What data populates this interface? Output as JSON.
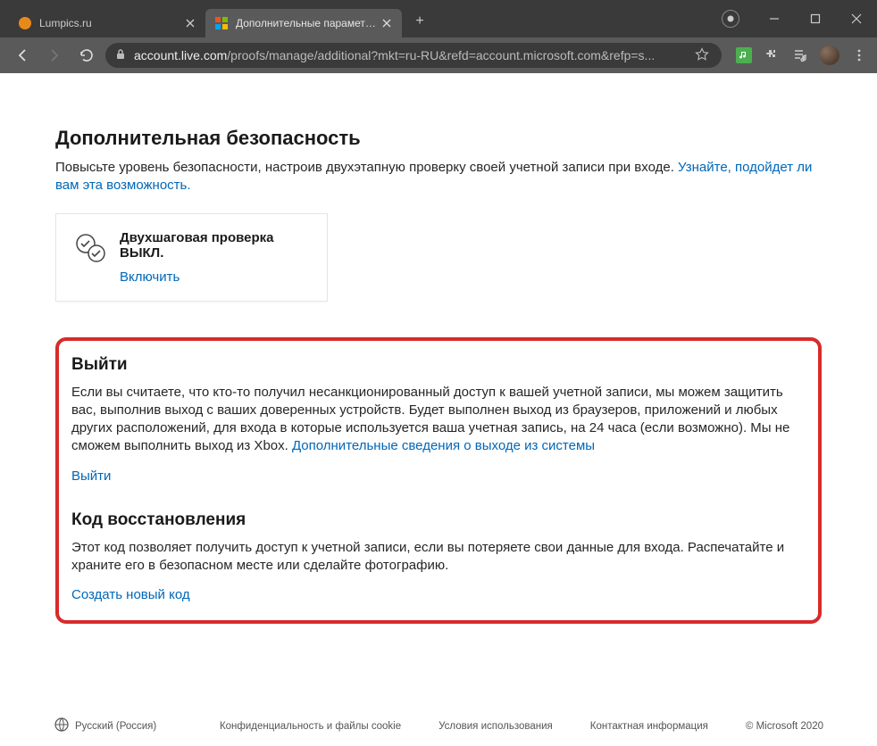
{
  "tabs": [
    {
      "title": "Lumpics.ru",
      "favicon_color": "#e88a1a",
      "active": false
    },
    {
      "title": "Дополнительные параметры бе",
      "favicon_type": "ms",
      "active": true
    }
  ],
  "toolbar": {
    "url_prefix": "",
    "url_domain": "account.live.com",
    "url_path": "/proofs/manage/additional?mkt=ru-RU&refd=account.microsoft.com&refp=s..."
  },
  "sections": {
    "additional_security": {
      "title": "Дополнительная безопасность",
      "desc": "Повысьте уровень безопасности, настроив двухэтапную проверку своей учетной записи при входе. ",
      "link1": "Узнайте, подойдет ли вам эта возможность."
    },
    "two_step_card": {
      "title": "Двухшаговая проверка",
      "status": "ВЫКЛ.",
      "enable": "Включить"
    },
    "sign_out": {
      "title": "Выйти",
      "desc1": "Если вы считаете, что кто-то получил несанкционированный доступ к вашей учетной записи, мы можем защитить вас, выполнив выход с ваших доверенных устройств. Будет выполнен выход из браузеров, приложений и любых других расположений, для входа в которые используется ваша учетная запись, на 24 часа (если возможно). Мы не сможем выполнить выход из Xbox. ",
      "desc_link": "Дополнительные сведения о выходе из системы",
      "action": "Выйти"
    },
    "recovery_code": {
      "title": "Код восстановления",
      "desc": "Этот код позволяет получить доступ к учетной записи, если вы потеряете свои данные для входа. Распечатайте и храните его в безопасном месте или сделайте фотографию.",
      "action": "Создать новый код"
    }
  },
  "footer": {
    "lang": "Русский (Россия)",
    "privacy": "Конфиденциальность и файлы cookie",
    "terms": "Условия использования",
    "contact": "Контактная информация",
    "copyright": "© Microsoft 2020"
  }
}
